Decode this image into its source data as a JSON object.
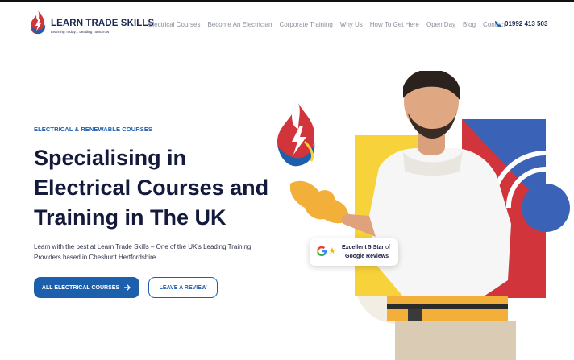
{
  "header": {
    "logo_name": "LEARN TRADE SKILLS",
    "logo_tagline": "Learning Today... Leading Tomorrow",
    "nav": [
      "Electrical Courses",
      "Become An Electrician",
      "Corporate Training",
      "Why Us",
      "How To Get Here",
      "Open Day",
      "Blog",
      "Contact"
    ],
    "phone": "01992 413 503",
    "phone_icon": "phone-icon"
  },
  "hero": {
    "eyebrow": "ELECTRICAL & RENEWABLE COURSES",
    "headline": [
      "Specialising in",
      "Electrical Courses and",
      "Training in The UK"
    ],
    "intro": "Learn with the best at Learn Trade Skills – One of the UK's Leading Training Providers based in Cheshunt Hertfordshire",
    "primary_button": "ALL ELECTRICAL COURSES",
    "primary_button_icon": "arrow-right-icon",
    "secondary_button": "LEAVE A REVIEW"
  },
  "review_badge": {
    "line1_bold": "Excellent 5 Star",
    "line1_rest": " of",
    "line2": "Google Reviews",
    "rating_icon": "star-icon",
    "brand_icon": "google-g-icon"
  },
  "colors": {
    "brand_blue": "#1c5fad",
    "navy": "#141a3c",
    "accent_red": "#d1343a",
    "accent_yellow": "#f7d23a",
    "shape_blue": "#3a63b8"
  }
}
